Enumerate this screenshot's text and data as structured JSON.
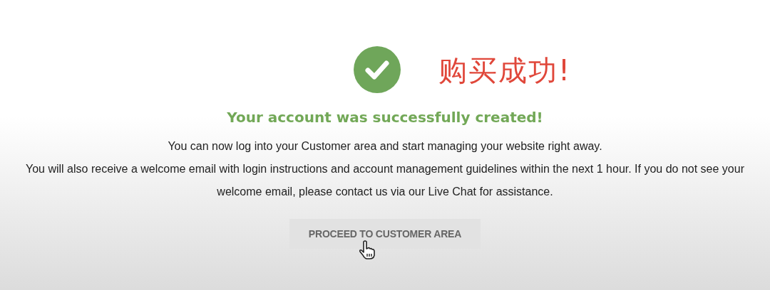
{
  "annotation": "购买成功!",
  "heading": "Your account was successfully created!",
  "paragraphs": [
    "You can now log into your Customer area and start managing your website right away.",
    "You will also receive a welcome email with login instructions and account management guidelines within the next 1 hour. If you do not see your welcome email, please contact us via our Live Chat for assistance."
  ],
  "button": {
    "label": "PROCEED TO CUSTOMER AREA"
  }
}
